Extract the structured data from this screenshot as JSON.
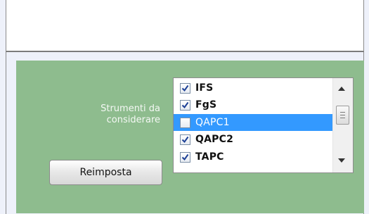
{
  "instruments": {
    "label": "Strumenti da considerare",
    "items": [
      {
        "name": "IFS",
        "checked": true,
        "selected": false
      },
      {
        "name": "FgS",
        "checked": true,
        "selected": false
      },
      {
        "name": "QAPC1",
        "checked": false,
        "selected": true
      },
      {
        "name": "QAPC2",
        "checked": true,
        "selected": false
      },
      {
        "name": "TAPC",
        "checked": true,
        "selected": false
      }
    ]
  },
  "reset_button": {
    "label": "Reimposta"
  },
  "colors": {
    "panel": "#8ebc8e",
    "selection": "#3399ff"
  }
}
